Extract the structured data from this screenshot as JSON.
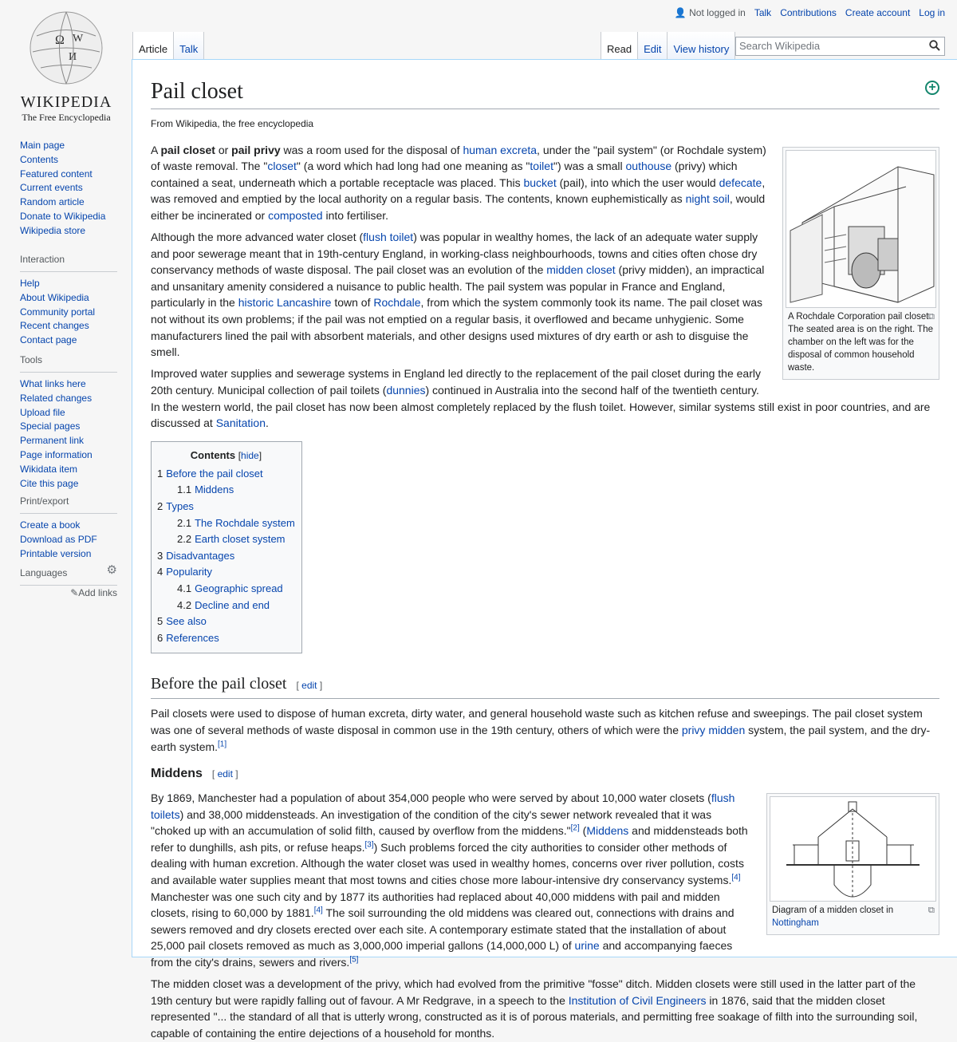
{
  "personal": {
    "not_logged": "Not logged in",
    "links": [
      "Talk",
      "Contributions",
      "Create account",
      "Log in"
    ]
  },
  "logo": {
    "wordmark": "Wikipedia",
    "tagline": "The Free Encyclopedia"
  },
  "sidebar": {
    "nav": [
      "Main page",
      "Contents",
      "Featured content",
      "Current events",
      "Random article",
      "Donate to Wikipedia",
      "Wikipedia store"
    ],
    "interaction": {
      "title": "Interaction",
      "items": [
        "Help",
        "About Wikipedia",
        "Community portal",
        "Recent changes",
        "Contact page"
      ]
    },
    "tools": {
      "title": "Tools",
      "items": [
        "What links here",
        "Related changes",
        "Upload file",
        "Special pages",
        "Permanent link",
        "Page information",
        "Wikidata item",
        "Cite this page"
      ]
    },
    "print": {
      "title": "Print/export",
      "items": [
        "Create a book",
        "Download as PDF",
        "Printable version"
      ]
    },
    "languages": {
      "title": "Languages",
      "add_links": "Add links"
    }
  },
  "tabs": {
    "left": [
      "Article",
      "Talk"
    ],
    "right": [
      "Read",
      "Edit",
      "View history"
    ]
  },
  "search": {
    "placeholder": "Search Wikipedia"
  },
  "page": {
    "title": "Pail closet",
    "tagline": "From Wikipedia, the free encyclopedia"
  },
  "figures": [
    {
      "caption": "A Rochdale Corporation pail closet. The seated area is on the right. The chamber on the left was for the disposal of common household waste."
    },
    {
      "caption_text": "Diagram of a midden closet in ",
      "caption_link": "Nottingham"
    }
  ],
  "intro": [
    [
      [
        "t",
        "A "
      ],
      [
        "b",
        "pail closet"
      ],
      [
        "t",
        " or "
      ],
      [
        "b",
        "pail privy"
      ],
      [
        "t",
        " was a room used for the disposal of "
      ],
      [
        "l",
        "human excreta"
      ],
      [
        "t",
        ", under the \"pail system\" (or Rochdale system) of waste removal. The \""
      ],
      [
        "l",
        "closet"
      ],
      [
        "t",
        "\" (a word which had long had one meaning as \""
      ],
      [
        "l",
        "toilet"
      ],
      [
        "t",
        "\") was a small "
      ],
      [
        "l",
        "outhouse"
      ],
      [
        "t",
        " (privy) which contained a seat, underneath which a portable receptacle was placed. This "
      ],
      [
        "l",
        "bucket"
      ],
      [
        "t",
        " (pail), into which the user would "
      ],
      [
        "l",
        "defecate"
      ],
      [
        "t",
        ", was removed and emptied by the local authority on a regular basis. The contents, known euphemistically as "
      ],
      [
        "l",
        "night soil"
      ],
      [
        "t",
        ", would either be incinerated or "
      ],
      [
        "l",
        "composted"
      ],
      [
        "t",
        " into fertiliser."
      ]
    ],
    [
      [
        "t",
        "Although the more advanced water closet ("
      ],
      [
        "l",
        "flush toilet"
      ],
      [
        "t",
        ") was popular in wealthy homes, the lack of an adequate water supply and poor sewerage meant that in 19th-century England, in working-class neighbourhoods, towns and cities often chose dry conservancy methods of waste disposal. The pail closet was an evolution of the "
      ],
      [
        "l",
        "midden closet"
      ],
      [
        "t",
        " (privy midden), an impractical and unsanitary amenity considered a nuisance to public health. The pail system was popular in France and England, particularly in the "
      ],
      [
        "l",
        "historic Lancashire"
      ],
      [
        "t",
        " town of "
      ],
      [
        "l",
        "Rochdale"
      ],
      [
        "t",
        ", from which the system commonly took its name. The pail closet was not without its own problems; if the pail was not emptied on a regular basis, it overflowed and became unhygienic. Some manufacturers lined the pail with absorbent materials, and other designs used mixtures of dry earth or ash to disguise the smell."
      ]
    ],
    [
      [
        "t",
        "Improved water supplies and sewerage systems in England led directly to the replacement of the pail closet during the early 20th century. Municipal collection of pail toilets ("
      ],
      [
        "l",
        "dunnies"
      ],
      [
        "t",
        ") continued in Australia into the second half of the twentieth century. In the western world, the pail closet has now been almost completely replaced by the flush toilet. However, similar systems still exist in poor countries, and are discussed at "
      ],
      [
        "l",
        "Sanitation"
      ],
      [
        "t",
        "."
      ]
    ]
  ],
  "toc": {
    "title": "Contents",
    "hide": "hide",
    "items": [
      {
        "n": "1",
        "t": "Before the pail closet",
        "lvl": 1
      },
      {
        "n": "1.1",
        "t": "Middens",
        "lvl": 2
      },
      {
        "n": "2",
        "t": "Types",
        "lvl": 1
      },
      {
        "n": "2.1",
        "t": "The Rochdale system",
        "lvl": 2
      },
      {
        "n": "2.2",
        "t": "Earth closet system",
        "lvl": 2
      },
      {
        "n": "3",
        "t": "Disadvantages",
        "lvl": 1
      },
      {
        "n": "4",
        "t": "Popularity",
        "lvl": 1
      },
      {
        "n": "4.1",
        "t": "Geographic spread",
        "lvl": 2
      },
      {
        "n": "4.2",
        "t": "Decline and end",
        "lvl": 2
      },
      {
        "n": "5",
        "t": "See also",
        "lvl": 1
      },
      {
        "n": "6",
        "t": "References",
        "lvl": 1
      }
    ]
  },
  "sections": {
    "before": {
      "title": "Before the pail closet",
      "edit": "edit"
    },
    "middens": {
      "title": "Middens",
      "edit": "edit"
    }
  },
  "before_paras": [
    [
      [
        "t",
        "Pail closets were used to dispose of human excreta, dirty water, and general household waste such as kitchen refuse and sweepings. The pail closet system was one of several methods of waste disposal in common use in the 19th century, others of which were the "
      ],
      [
        "l",
        "privy midden"
      ],
      [
        "t",
        " system, the pail system, and the dry-earth system."
      ],
      [
        "r",
        "[1]"
      ]
    ]
  ],
  "middens_paras": [
    [
      [
        "t",
        "By 1869, Manchester had a population of about 354,000 people who were served by about 10,000 water closets ("
      ],
      [
        "l",
        "flush toilets"
      ],
      [
        "t",
        ") and 38,000 middensteads. An investigation of the condition of the city's sewer network revealed that it was \"choked up with an accumulation of solid filth, caused by overflow from the middens.\""
      ],
      [
        "r",
        "[2]"
      ],
      [
        "t",
        " ("
      ],
      [
        "l",
        "Middens"
      ],
      [
        "t",
        " and middensteads both refer to dunghills, ash pits, or refuse heaps."
      ],
      [
        "r",
        "[3]"
      ],
      [
        "t",
        ") Such problems forced the city authorities to consider other methods of dealing with human excretion. Although the water closet was used in wealthy homes, concerns over river pollution, costs and available water supplies meant that most towns and cities chose more labour-intensive dry conservancy systems."
      ],
      [
        "r",
        "[4]"
      ],
      [
        "t",
        " Manchester was one such city and by 1877 its authorities had replaced about 40,000 middens with pail and midden closets, rising to 60,000 by 1881."
      ],
      [
        "r",
        "[4]"
      ],
      [
        "t",
        " The soil surrounding the old middens was cleared out, connections with drains and sewers removed and dry closets erected over each site. A contemporary estimate stated that the installation of about 25,000 pail closets removed as much as 3,000,000 imperial gallons (14,000,000 L) of "
      ],
      [
        "l",
        "urine"
      ],
      [
        "t",
        " and accompanying faeces from the city's drains, sewers and rivers."
      ],
      [
        "r",
        "[5]"
      ]
    ],
    [
      [
        "t",
        "The midden closet was a development of the privy, which had evolved from the primitive \"fosse\" ditch. Midden closets were still used in the latter part of the 19th century but were rapidly falling out of favour. A Mr Redgrave, in a speech to the "
      ],
      [
        "l",
        "Institution of Civil Engineers"
      ],
      [
        "t",
        " in 1876, said that the midden closet represented \"... the standard of all that is utterly wrong, constructed as it is of porous materials, and permitting free soakage of filth into the surrounding soil, capable of containing the entire dejections of a household for months."
      ]
    ]
  ],
  "colors": {
    "link": "#0645ad",
    "border": "#a7d7f9",
    "sidebar_bg": "#f6f6f6",
    "add_icon": "#14866d"
  }
}
